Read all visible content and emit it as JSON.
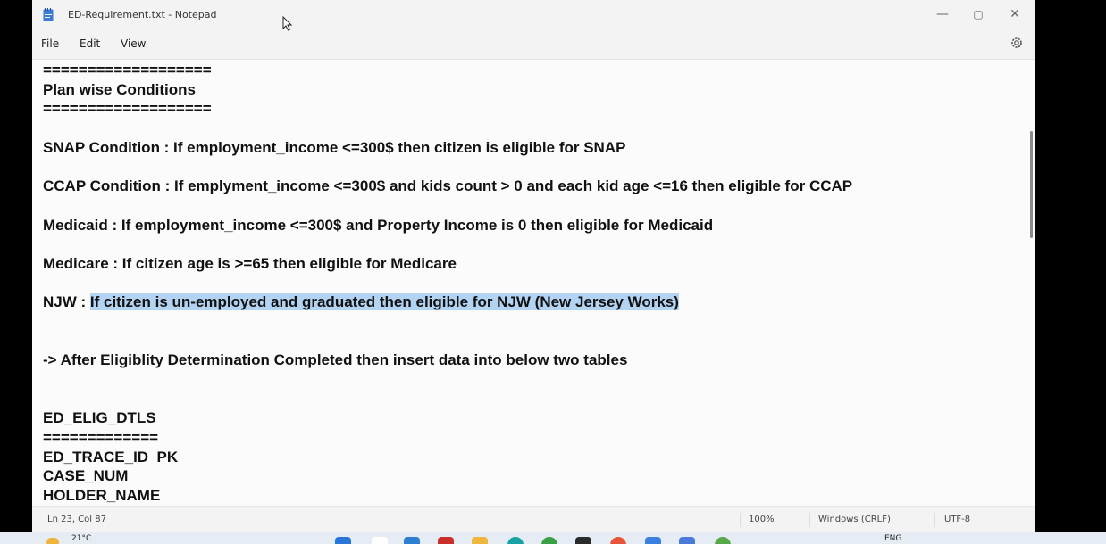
{
  "window": {
    "title": "ED-Requirement.txt - Notepad",
    "controls": {
      "minimize": "—",
      "maximize": "▢",
      "close": "✕"
    }
  },
  "menu": {
    "file": "File",
    "edit": "Edit",
    "view": "View"
  },
  "editor": {
    "lines": [
      "===================",
      "Plan wise Conditions",
      "===================",
      "",
      "SNAP Condition : If employment_income <=300$ then citizen is eligible for SNAP",
      "",
      "CCAP Condition : If emplyment_income <=300$ and kids count > 0 and each kid age <=16 then eligible for CCAP",
      "",
      "Medicaid : If employment_income <=300$ and Property Income is 0 then eligible for Medicaid",
      "",
      "Medicare : If citizen age is >=65 then eligible for Medicare",
      "",
      "NJW : ",
      "",
      "",
      "-> After Eligiblity Determination Completed then insert data into below two tables",
      "",
      "",
      "ED_ELIG_DTLS",
      "=============",
      "ED_TRACE_ID  PK",
      "CASE_NUM",
      "HOLDER_NAME"
    ],
    "selected_text": "If citizen is un-employed and graduated then eligible for NJW (New Jersey Works)"
  },
  "status": {
    "position": "Ln 23, Col 87",
    "zoom": "100%",
    "line_ending": "Windows (CRLF)",
    "encoding": "UTF-8"
  },
  "taskbar": {
    "temperature": "21°C",
    "language": "ENG"
  },
  "icons": {
    "app": "notepad-icon",
    "settings": "gear-icon"
  }
}
